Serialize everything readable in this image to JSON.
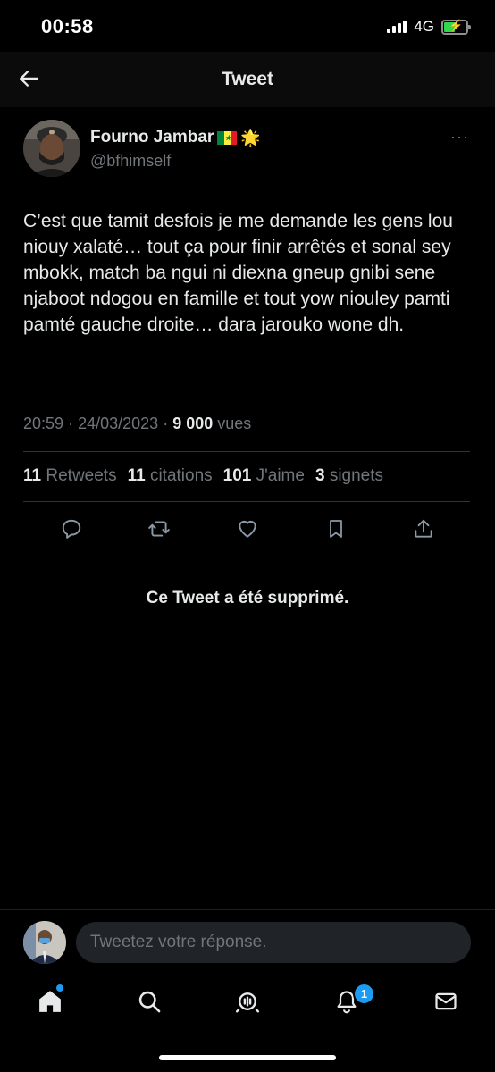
{
  "status_bar": {
    "time": "00:58",
    "network": "4G",
    "battery_level": 0.45,
    "battery_charging": true
  },
  "header": {
    "title": "Tweet",
    "back_icon": "arrow-left-icon"
  },
  "tweet": {
    "author": {
      "name": "Fourno Jambar",
      "emojis": [
        "senegal-flag",
        "glowing-star"
      ],
      "star_glyph": "🌟",
      "handle": "@bfhimself",
      "more_glyph": "···"
    },
    "text": "C’est que tamit desfois je me demande les gens lou niouy xalaté… tout ça pour finir arrêtés et sonal sey mbokk, match ba ngui ni diexna gneup gnibi sene njaboot ndogou en famille et tout yow niouley pamti pamté gauche droite… dara jarouko wone dh.",
    "time": "20:59",
    "date": "24/03/2023",
    "separator": "·",
    "views_count": "9 000",
    "views_label": "vues",
    "stats": {
      "retweets_count": "11",
      "retweets_label": "Retweets",
      "quotes_count": "11",
      "quotes_label": "citations",
      "likes_count": "101",
      "likes_label": "J'aime",
      "bookmarks_count": "3",
      "bookmarks_label": "signets"
    },
    "actions": [
      "reply-icon",
      "retweet-icon",
      "like-icon",
      "bookmark-icon",
      "share-icon"
    ]
  },
  "deleted_notice": "Ce Tweet a été supprimé.",
  "reply": {
    "placeholder": "Tweetez votre réponse."
  },
  "tab_bar": {
    "tabs": [
      "home-icon",
      "search-icon",
      "spaces-icon",
      "notifications-icon",
      "messages-icon"
    ],
    "notifications_badge": "1",
    "accent": "#1d9bf0"
  },
  "colors": {
    "background": "#000000",
    "text": "#e7e9ea",
    "secondary": "#71767b",
    "accent": "#1d9bf0"
  }
}
